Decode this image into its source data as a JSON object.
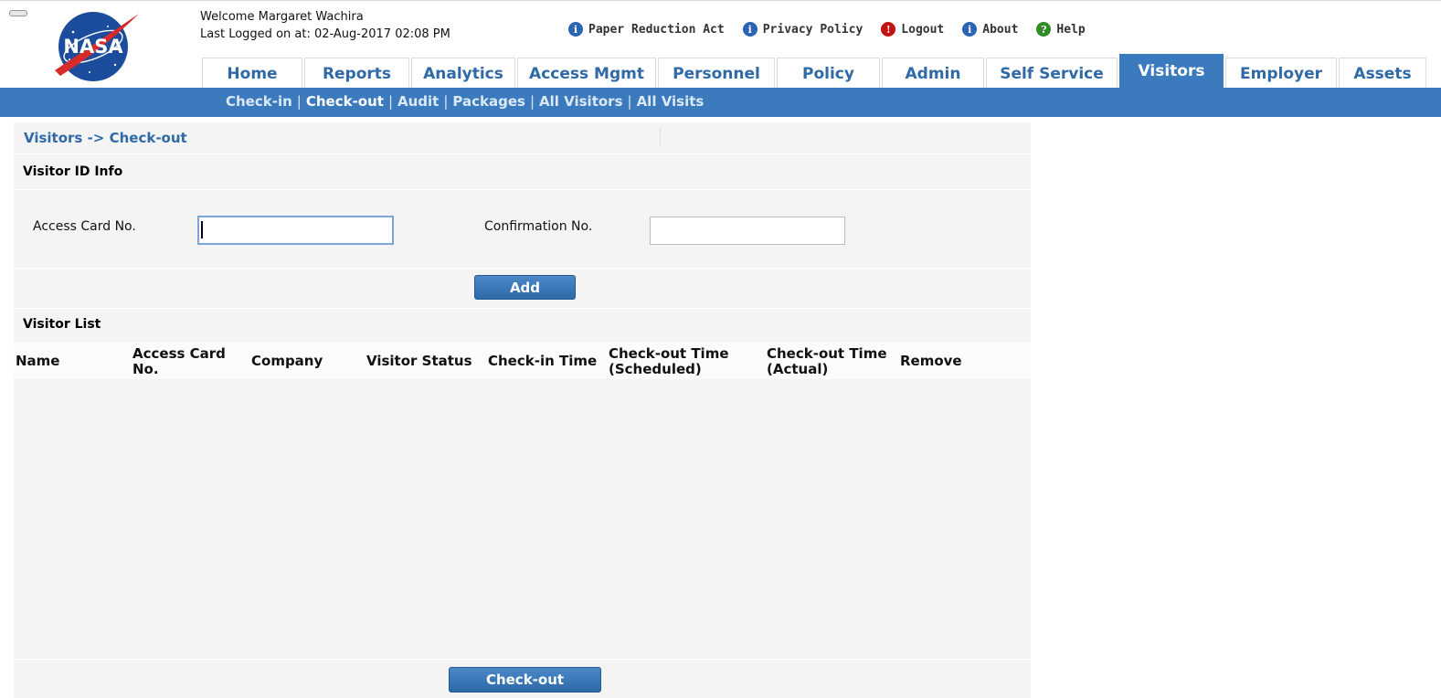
{
  "header": {
    "logo_text": "NASA",
    "welcome": "Welcome Margaret Wachira",
    "last_logged": "Last Logged on at: 02-Aug-2017 02:08 PM",
    "top_links": [
      {
        "label": "Paper Reduction Act",
        "icon": "info-icon"
      },
      {
        "label": "Privacy Policy",
        "icon": "info-icon"
      },
      {
        "label": "Logout",
        "icon": "logout-icon"
      },
      {
        "label": "About",
        "icon": "info-icon"
      },
      {
        "label": "Help",
        "icon": "help-icon"
      }
    ]
  },
  "tabs": [
    "Home",
    "Reports",
    "Analytics",
    "Access Mgmt",
    "Personnel",
    "Policy",
    "Admin",
    "Self Service",
    "Visitors",
    "Employer",
    "Assets"
  ],
  "active_tab": "Visitors",
  "subnav": {
    "items": [
      "Check-in",
      "Check-out",
      "Audit",
      "Packages",
      "All Visitors",
      "All Visits"
    ],
    "current": "Check-out",
    "separator": "|"
  },
  "breadcrumb": "Visitors -> Check-out",
  "visitor_id_info": {
    "title": "Visitor ID Info",
    "access_card_label": "Access Card No.",
    "access_card_value": "",
    "confirmation_label": "Confirmation No.",
    "confirmation_value": "",
    "add_label": "Add"
  },
  "visitor_list": {
    "title": "Visitor List",
    "columns": {
      "name": "Name",
      "access_card_1": "Access Card",
      "access_card_2": "No.",
      "company": "Company",
      "visitor_status": "Visitor Status",
      "checkin_time": "Check-in Time",
      "checkout_sched_1": "Check-out Time",
      "checkout_sched_2": "(Scheduled)",
      "checkout_actual_1": "Check-out Time",
      "checkout_actual_2": "(Actual)",
      "remove": "Remove"
    },
    "rows": []
  },
  "checkout_label": "Check-out",
  "colors": {
    "accent": "#3b7abd",
    "link": "#2f69a8",
    "panel_bg": "#f4f4f4"
  }
}
